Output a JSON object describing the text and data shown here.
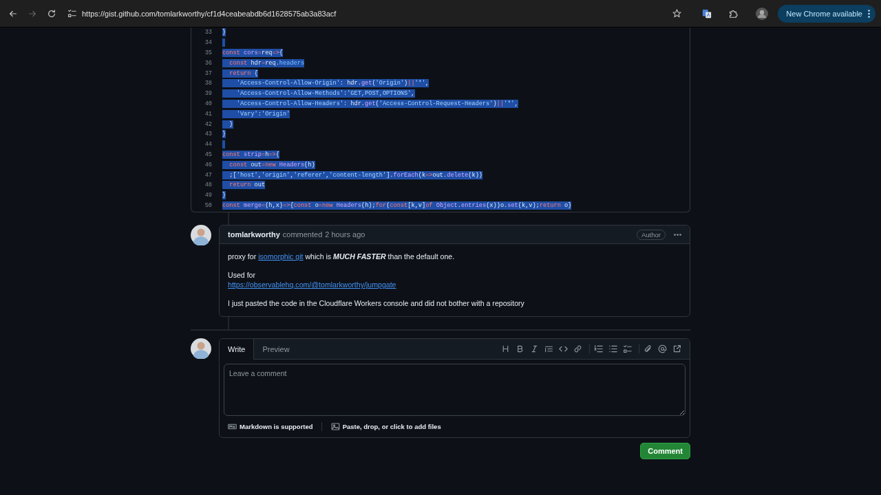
{
  "browser": {
    "nav_buttons": [
      {
        "kind": "back",
        "disabled": false
      },
      {
        "kind": "forward",
        "disabled": true
      },
      {
        "kind": "reload",
        "disabled": false
      }
    ],
    "url": "https://gist.github.com/tomlarkworthy/cf1d4ceabeabdb6d1628575ab3a83acf",
    "update_button": {
      "label": "New Chrome available"
    }
  },
  "code": {
    "lines": [
      {
        "number": "33",
        "selected": true,
        "tokens": [
          {
            "kind": "plain",
            "text": "}"
          }
        ]
      },
      {
        "number": "34",
        "selected": true
      },
      {
        "number": "35",
        "selected": true,
        "tokens": [
          {
            "kind": "kw",
            "text": "const "
          },
          {
            "kind": "fn",
            "text": "cors"
          },
          {
            "kind": "kw",
            "text": "="
          },
          {
            "kind": "plain",
            "text": "req"
          },
          {
            "kind": "kw",
            "text": "=>"
          },
          {
            "kind": "plain",
            "text": "{"
          }
        ]
      },
      {
        "number": "36",
        "selected": true,
        "tokens": [
          {
            "kind": "kw",
            "text": "  const "
          },
          {
            "kind": "plain",
            "text": "hdr"
          },
          {
            "kind": "kw",
            "text": "="
          },
          {
            "kind": "plain",
            "text": "req."
          },
          {
            "kind": "prop",
            "text": "headers"
          }
        ]
      },
      {
        "number": "37",
        "selected": true,
        "tokens": [
          {
            "kind": "kw",
            "text": "  return"
          },
          {
            "kind": "plain",
            "text": " {"
          }
        ]
      },
      {
        "number": "38",
        "selected": true,
        "tokens": [
          {
            "kind": "str",
            "text": "    'Access-Control-Allow-Origin'"
          },
          {
            "kind": "plain",
            "text": ": hdr."
          },
          {
            "kind": "fn",
            "text": "get"
          },
          {
            "kind": "plain",
            "text": "("
          },
          {
            "kind": "str",
            "text": "'Origin'"
          },
          {
            "kind": "plain",
            "text": ")"
          },
          {
            "kind": "kw",
            "text": "||"
          },
          {
            "kind": "str",
            "text": "'*'"
          },
          {
            "kind": "plain",
            "text": ","
          }
        ]
      },
      {
        "number": "39",
        "selected": true,
        "tokens": [
          {
            "kind": "str",
            "text": "    'Access-Control-Allow-Methods'"
          },
          {
            "kind": "plain",
            "text": ":"
          },
          {
            "kind": "str",
            "text": "'GET,POST,OPTIONS'"
          },
          {
            "kind": "plain",
            "text": ","
          }
        ]
      },
      {
        "number": "40",
        "selected": true,
        "tokens": [
          {
            "kind": "str",
            "text": "    'Access-Control-Allow-Headers'"
          },
          {
            "kind": "plain",
            "text": ": hdr."
          },
          {
            "kind": "fn",
            "text": "get"
          },
          {
            "kind": "plain",
            "text": "("
          },
          {
            "kind": "str",
            "text": "'Access-Control-Request-Headers'"
          },
          {
            "kind": "plain",
            "text": ")"
          },
          {
            "kind": "kw",
            "text": "||"
          },
          {
            "kind": "str",
            "text": "'*'"
          },
          {
            "kind": "plain",
            "text": ","
          }
        ]
      },
      {
        "number": "41",
        "selected": true,
        "tokens": [
          {
            "kind": "str",
            "text": "    'Vary'"
          },
          {
            "kind": "plain",
            "text": ":"
          },
          {
            "kind": "str",
            "text": "'Origin'"
          }
        ]
      },
      {
        "number": "42",
        "selected": true,
        "tokens": [
          {
            "kind": "plain",
            "text": "  }"
          }
        ]
      },
      {
        "number": "43",
        "selected": true,
        "tokens": [
          {
            "kind": "plain",
            "text": "}"
          }
        ]
      },
      {
        "number": "44",
        "selected": true
      },
      {
        "number": "45",
        "selected": true,
        "tokens": [
          {
            "kind": "kw",
            "text": "const "
          },
          {
            "kind": "fn",
            "text": "strip"
          },
          {
            "kind": "kw",
            "text": "="
          },
          {
            "kind": "plain",
            "text": "h"
          },
          {
            "kind": "kw",
            "text": "=>"
          },
          {
            "kind": "plain",
            "text": "{"
          }
        ]
      },
      {
        "number": "46",
        "selected": true,
        "tokens": [
          {
            "kind": "kw",
            "text": "  const "
          },
          {
            "kind": "plain",
            "text": "out"
          },
          {
            "kind": "kw",
            "text": "=new "
          },
          {
            "kind": "fn",
            "text": "Headers"
          },
          {
            "kind": "plain",
            "text": "(h)"
          }
        ]
      },
      {
        "number": "47",
        "selected": true,
        "tokens": [
          {
            "kind": "plain",
            "text": "  ;["
          },
          {
            "kind": "str",
            "text": "'host'"
          },
          {
            "kind": "plain",
            "text": ","
          },
          {
            "kind": "str",
            "text": "'origin'"
          },
          {
            "kind": "plain",
            "text": ","
          },
          {
            "kind": "str",
            "text": "'referer'"
          },
          {
            "kind": "plain",
            "text": ","
          },
          {
            "kind": "str",
            "text": "'content-length'"
          },
          {
            "kind": "plain",
            "text": "]."
          },
          {
            "kind": "fn",
            "text": "forEach"
          },
          {
            "kind": "plain",
            "text": "(k"
          },
          {
            "kind": "kw",
            "text": "=>"
          },
          {
            "kind": "plain",
            "text": "out."
          },
          {
            "kind": "fn",
            "text": "delete"
          },
          {
            "kind": "plain",
            "text": "(k))"
          }
        ]
      },
      {
        "number": "48",
        "selected": true,
        "tokens": [
          {
            "kind": "kw",
            "text": "  return "
          },
          {
            "kind": "plain",
            "text": "out"
          }
        ]
      },
      {
        "number": "49",
        "selected": true,
        "tokens": [
          {
            "kind": "plain",
            "text": "}"
          }
        ]
      },
      {
        "number": "50",
        "selected": true,
        "tokens": [
          {
            "kind": "kw",
            "text": "const "
          },
          {
            "kind": "fn",
            "text": "merge"
          },
          {
            "kind": "kw",
            "text": "="
          },
          {
            "kind": "plain",
            "text": "(h,x)"
          },
          {
            "kind": "kw",
            "text": "=>"
          },
          {
            "kind": "plain",
            "text": "{"
          },
          {
            "kind": "kw",
            "text": "const "
          },
          {
            "kind": "plain",
            "text": "o"
          },
          {
            "kind": "kw",
            "text": "=new "
          },
          {
            "kind": "fn",
            "text": "Headers"
          },
          {
            "kind": "plain",
            "text": "(h);"
          },
          {
            "kind": "kw",
            "text": "for"
          },
          {
            "kind": "plain",
            "text": "("
          },
          {
            "kind": "kw",
            "text": "const"
          },
          {
            "kind": "plain",
            "text": "[k,v]"
          },
          {
            "kind": "kw",
            "text": "of "
          },
          {
            "kind": "fn",
            "text": "Object"
          },
          {
            "kind": "plain",
            "text": "."
          },
          {
            "kind": "fn",
            "text": "entries"
          },
          {
            "kind": "plain",
            "text": "(x))o."
          },
          {
            "kind": "fn",
            "text": "set"
          },
          {
            "kind": "plain",
            "text": "(k,v);"
          },
          {
            "kind": "kw",
            "text": "return "
          },
          {
            "kind": "plain",
            "text": "o}"
          }
        ]
      }
    ]
  },
  "comment": {
    "author": "tomlarkworthy",
    "action": "commented",
    "time": "2 hours ago",
    "badge": "Author",
    "paragraphs": [
      {
        "segments": [
          {
            "kind": "text",
            "text": "proxy for "
          },
          {
            "kind": "link",
            "text": "isomorphic git"
          },
          {
            "kind": "text",
            "text": " which is "
          },
          {
            "kind": "emphasis",
            "text": "MUCH FASTER"
          },
          {
            "kind": "text",
            "text": " than the default one."
          }
        ]
      },
      {
        "segments": [
          {
            "kind": "text",
            "text": "Used for"
          },
          {
            "kind": "break"
          },
          {
            "kind": "link",
            "text": "https://observablehq.com/@tomlarkworthy/jumpgate"
          }
        ]
      },
      {
        "segments": [
          {
            "kind": "text",
            "text": "I just pasted the code in the Cloudflare Workers console and did not bother with a repository"
          }
        ]
      }
    ]
  },
  "editor": {
    "tabs": [
      {
        "label": "Write",
        "selected": true
      },
      {
        "label": "Preview",
        "selected": false
      }
    ],
    "toolbar_groups": [
      {
        "tools": [
          {
            "kind": "heading"
          },
          {
            "kind": "bold"
          },
          {
            "kind": "italic"
          },
          {
            "kind": "quote"
          },
          {
            "kind": "code"
          },
          {
            "kind": "link"
          }
        ]
      },
      {
        "tools": [
          {
            "kind": "ordered_list"
          },
          {
            "kind": "unordered_list"
          },
          {
            "kind": "task_list"
          }
        ]
      },
      {
        "tools": [
          {
            "kind": "attach"
          },
          {
            "kind": "mention"
          },
          {
            "kind": "reference"
          }
        ]
      }
    ],
    "placeholder": "Leave a comment",
    "footer_notes": [
      {
        "kind": "markdown",
        "text": "Markdown is supported"
      },
      {
        "kind": "image",
        "text": "Paste, drop, or click to add files"
      }
    ],
    "submit": {
      "label": "Comment"
    }
  }
}
